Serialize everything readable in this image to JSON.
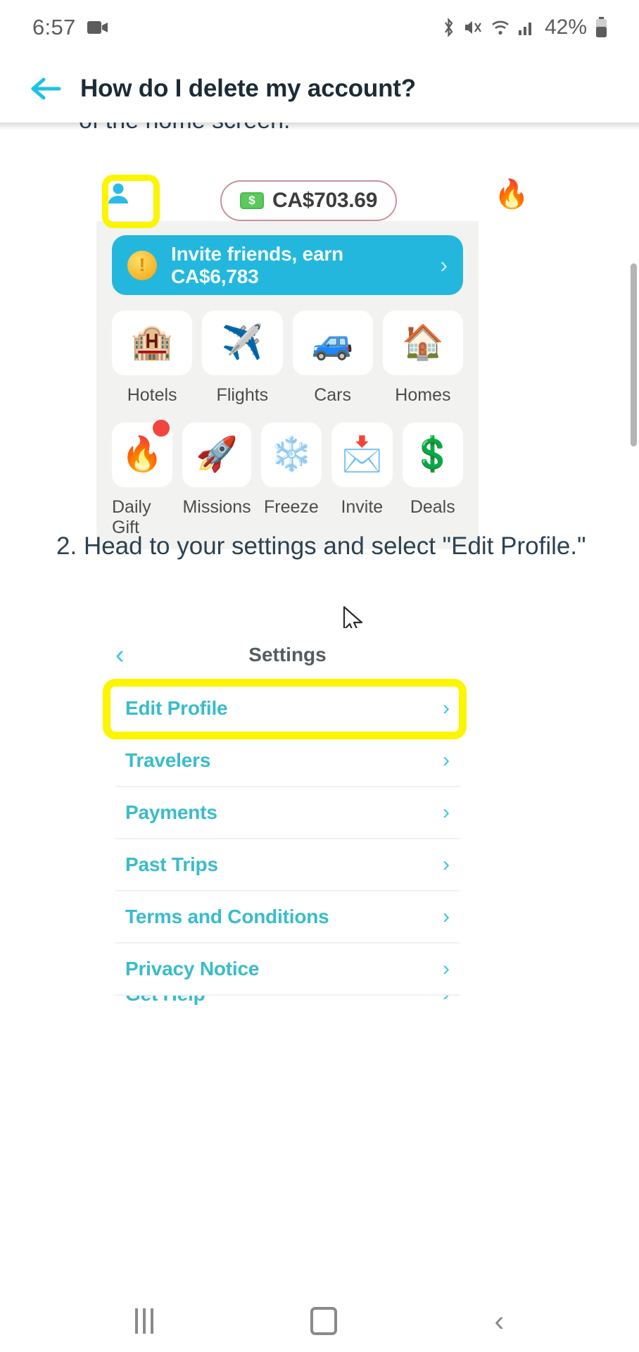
{
  "status_bar": {
    "time": "6:57",
    "battery_percent": "42%",
    "icons": [
      "video-recording-icon",
      "bluetooth-icon",
      "mute-icon",
      "wifi-icon",
      "signal-icon",
      "battery-icon"
    ]
  },
  "header": {
    "title": "How do I delete my account?",
    "back_label": "←"
  },
  "article": {
    "clipped_top_text": "of the home screen.",
    "step2": {
      "number": "2.",
      "text": "Head to your settings and select \"Edit Profile.\""
    }
  },
  "app_home_screenshot": {
    "avatar_icon": "person-icon",
    "balance": "CA$703.69",
    "money_icon": "dollar-bill-icon",
    "streak_icon": "🔥",
    "invite_banner": {
      "text": "Invite friends, earn CA$6,783",
      "coin_icon": "gold-coin-icon",
      "chevron": "›"
    },
    "tiles_row1": [
      {
        "label": "Hotels",
        "emoji": "🏨",
        "icon_name": "hotel-icon",
        "badge": false
      },
      {
        "label": "Flights",
        "emoji": "✈️",
        "icon_name": "airplane-icon",
        "badge": false
      },
      {
        "label": "Cars",
        "emoji": "🚙",
        "icon_name": "car-icon",
        "badge": false
      },
      {
        "label": "Homes",
        "emoji": "🏠",
        "icon_name": "house-icon",
        "badge": false
      }
    ],
    "tiles_row2": [
      {
        "label": "Daily Gift",
        "emoji": "🔥",
        "icon_name": "flame-icon",
        "badge": true
      },
      {
        "label": "Missions",
        "emoji": "🚀",
        "icon_name": "rocket-icon",
        "badge": false
      },
      {
        "label": "Freeze",
        "emoji": "❄️",
        "icon_name": "snowflake-icon",
        "badge": false
      },
      {
        "label": "Invite",
        "emoji": "📩",
        "icon_name": "envelope-coin-icon",
        "badge": false
      },
      {
        "label": "Deals",
        "emoji": "💲",
        "icon_name": "percent-tag-icon",
        "badge": false
      }
    ]
  },
  "app_settings_screenshot": {
    "back_chevron": "‹",
    "title": "Settings",
    "rows": [
      {
        "label": "Edit Profile",
        "chevron": "›",
        "highlighted": true
      },
      {
        "label": "Travelers",
        "chevron": "›",
        "highlighted": false
      },
      {
        "label": "Payments",
        "chevron": "›",
        "highlighted": false
      },
      {
        "label": "Past Trips",
        "chevron": "›",
        "highlighted": false
      },
      {
        "label": "Terms and Conditions",
        "chevron": "›",
        "highlighted": false
      },
      {
        "label": "Privacy Notice",
        "chevron": "›",
        "highlighted": false
      },
      {
        "label": "Get Help",
        "chevron": "›",
        "highlighted": false
      }
    ]
  },
  "nav_bar": {
    "recent_label": "recent-apps",
    "home_label": "home",
    "back_label": "back"
  },
  "colors": {
    "accent_cyan": "#3ec8e0",
    "banner_blue": "#23b7de",
    "highlight_yellow": "#fbf500",
    "link_teal": "#39bcc9"
  }
}
